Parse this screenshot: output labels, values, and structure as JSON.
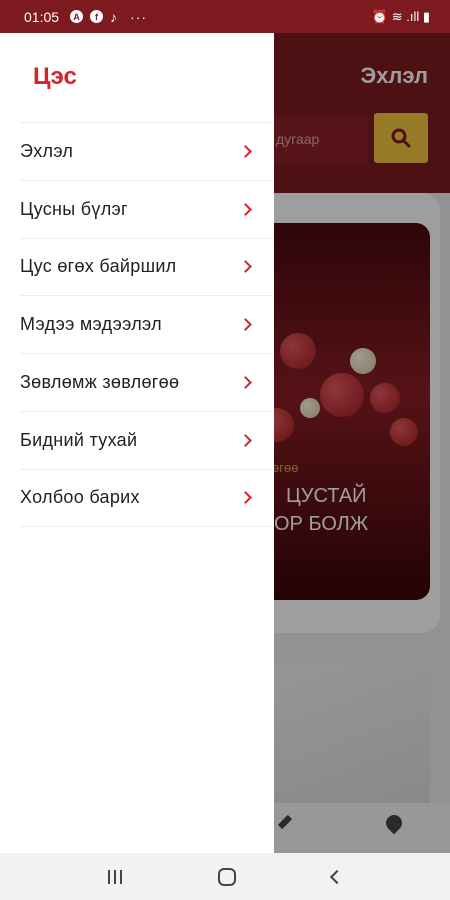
{
  "status_bar": {
    "time": "01:05",
    "notification_icons": [
      "A",
      "f"
    ],
    "music_icon": "♪",
    "overflow": "···",
    "right_icons": "⏰ ≋ .ıll ▮"
  },
  "background_app": {
    "title": "Эхлэл",
    "search_placeholder": "дугаар",
    "banner_subtitle": "өгөө",
    "banner_line1": "ЦУСТАЙ",
    "banner_line2": "ОР БОЛЖ"
  },
  "drawer": {
    "title": "Цэс",
    "items": [
      {
        "label": "Эхлэл"
      },
      {
        "label": "Цусны бүлэг"
      },
      {
        "label": "Цус өгөх байршил"
      },
      {
        "label": "Мэдээ мэдээлэл"
      },
      {
        "label": "Зөвлөмж зөвлөгөө"
      },
      {
        "label": "Бидний тухай"
      },
      {
        "label": "Холбоо барих"
      }
    ]
  },
  "colors": {
    "accent": "#d7212b",
    "header": "#7d1a1f",
    "search_button": "#f2c53c"
  }
}
